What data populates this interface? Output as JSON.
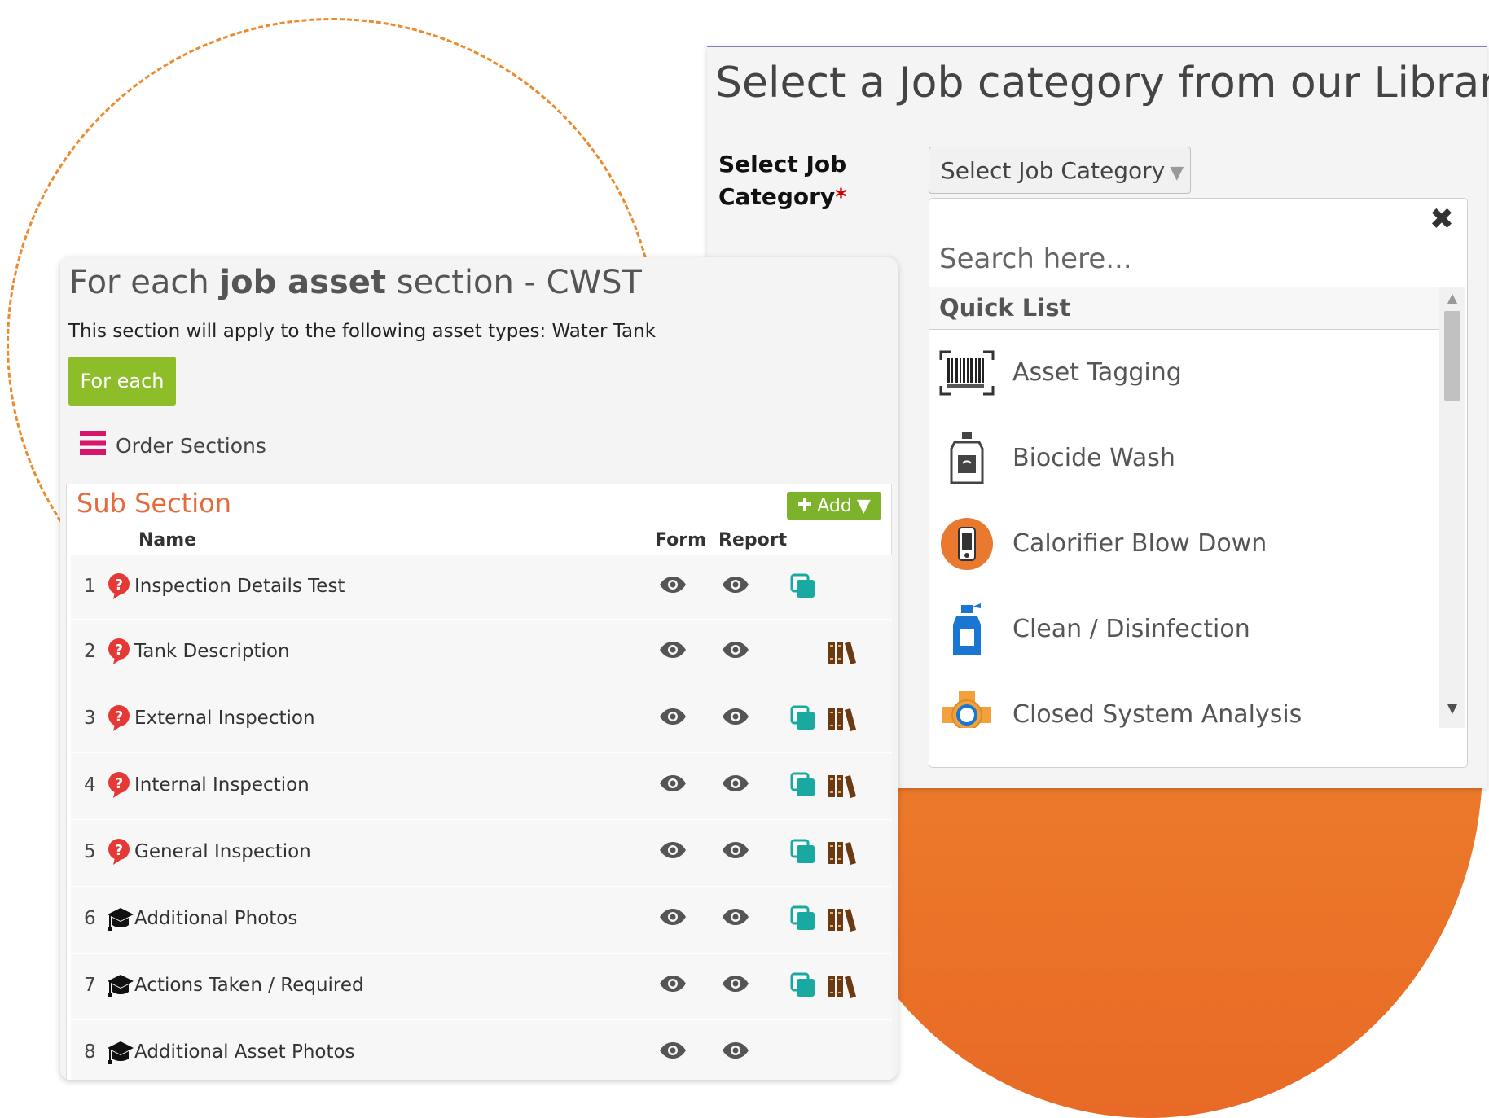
{
  "library_panel": {
    "title": "Select a Job category from our Library",
    "field_label": "Select Job Category",
    "required_mark": "*",
    "select_value": "Select Job Category",
    "dropdown": {
      "close_glyph": "✖",
      "search_placeholder": "Search here...",
      "group_label": "Quick List",
      "items": [
        {
          "label": "Asset Tagging",
          "icon": "barcode-icon"
        },
        {
          "label": "Biocide Wash",
          "icon": "chemical-bottle-icon"
        },
        {
          "label": "Calorifier Blow Down",
          "icon": "calorifier-icon"
        },
        {
          "label": "Clean / Disinfection",
          "icon": "spray-bottle-icon"
        },
        {
          "label": "Closed System Analysis",
          "icon": "pipe-sensor-icon"
        }
      ]
    }
  },
  "section_panel": {
    "title_prefix": "For each ",
    "title_bold": "job asset",
    "title_suffix": " section - CWST",
    "description": "This section will apply to the following asset types: Water Tank",
    "foreach_button": "For each",
    "order_sections": "Order Sections",
    "subsection": {
      "title": "Sub Section",
      "add_button": "Add",
      "columns": {
        "name": "Name",
        "form": "Form",
        "report": "Report"
      },
      "rows": [
        {
          "num": "1",
          "name": "Inspection Details Test",
          "type": "question",
          "copy": true,
          "library": false
        },
        {
          "num": "2",
          "name": "Tank Description",
          "type": "question",
          "copy": false,
          "library": true
        },
        {
          "num": "3",
          "name": "External Inspection",
          "type": "question",
          "copy": true,
          "library": true
        },
        {
          "num": "4",
          "name": "Internal Inspection",
          "type": "question",
          "copy": true,
          "library": true
        },
        {
          "num": "5",
          "name": "General Inspection",
          "type": "question",
          "copy": true,
          "library": true
        },
        {
          "num": "6",
          "name": "Additional Photos",
          "type": "training",
          "copy": true,
          "library": true
        },
        {
          "num": "7",
          "name": "Actions Taken / Required",
          "type": "training",
          "copy": true,
          "library": true
        },
        {
          "num": "8",
          "name": "Additional Asset Photos",
          "type": "training",
          "copy": false,
          "library": false
        }
      ]
    }
  },
  "colors": {
    "accent_orange": "#e86a26",
    "foreach_green": "#8ebd2a",
    "add_green": "#7cb32a",
    "subsection_title": "#e46b3b",
    "order_icon": "#d6166a",
    "question_red": "#e53935",
    "copy_teal": "#1aa9a0",
    "books_brown": "#6b3a12"
  }
}
